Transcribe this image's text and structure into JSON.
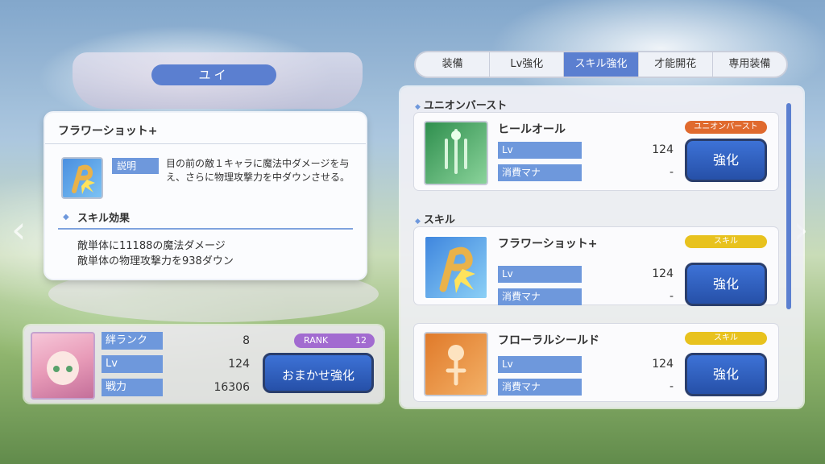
{
  "character": {
    "name": "ユイ"
  },
  "popup": {
    "title": "フラワーショット+",
    "desc_label": "説明",
    "description": "目の前の敵１キャラに魔法中ダメージを与え、さらに物理攻撃力を中ダウンさせる。",
    "effect_title": "スキル効果",
    "effect_line1": "敵単体に11188の魔法ダメージ",
    "effect_line2": "敵単体の物理攻撃力を938ダウン"
  },
  "stats": {
    "bond_label": "絆ランク",
    "bond_value": "8",
    "lv_label": "Lv",
    "lv_value": "124",
    "power_label": "戦力",
    "power_value": "16306",
    "rank_label": "RANK",
    "rank_value": "12",
    "auto_button": "おまかせ強化"
  },
  "tabs": [
    "装備",
    "Lv強化",
    "スキル強化",
    "才能開花",
    "専用装備"
  ],
  "active_tab": "スキル強化",
  "sections": {
    "union": "ユニオンバースト",
    "skill": "スキル"
  },
  "skills": [
    {
      "name": "ヒールオール",
      "badge": "ユニオンバースト",
      "badge_color": "#e06a2e",
      "lv_label": "Lv",
      "lv": "124",
      "mana_label": "消費マナ",
      "mana": "-",
      "button": "強化",
      "icon_color": "#4fae6a"
    },
    {
      "name": "フラワーショット+",
      "badge": "スキル",
      "badge_color": "#e8c21e",
      "lv_label": "Lv",
      "lv": "124",
      "mana_label": "消費マナ",
      "mana": "-",
      "button": "強化",
      "icon_color": "#4a8fe0"
    },
    {
      "name": "フローラルシールド",
      "badge": "スキル",
      "badge_color": "#e8c21e",
      "lv_label": "Lv",
      "lv": "124",
      "mana_label": "消費マナ",
      "mana": "-",
      "button": "強化",
      "icon_color": "#e08a3a"
    }
  ],
  "icons": {
    "nav_left": "chevron-left-icon",
    "nav_right": "chevron-right-icon"
  }
}
